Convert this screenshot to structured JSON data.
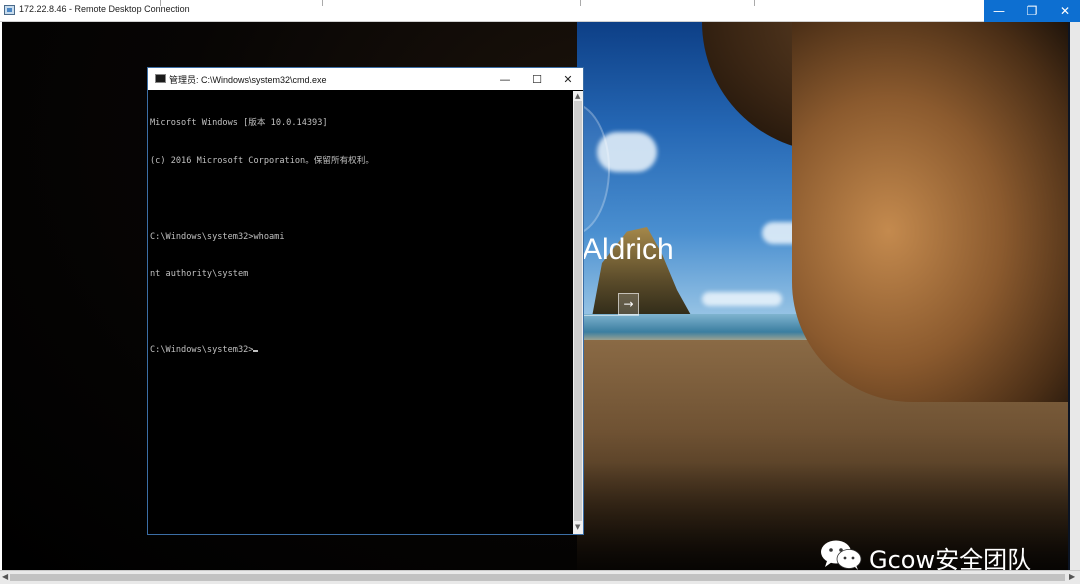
{
  "rdp": {
    "title": "172.22.8.46 - Remote Desktop Connection",
    "controls": {
      "minimize": "—",
      "restore": "❐",
      "close": "✕"
    },
    "accent": "#0d6fd1"
  },
  "lock_screen": {
    "username": "Aldrich",
    "submit_icon": "→"
  },
  "cmd": {
    "title": "管理员: C:\\Windows\\system32\\cmd.exe",
    "controls": {
      "minimize": "—",
      "maximize": "☐",
      "close": "✕"
    },
    "lines": [
      "Microsoft Windows [版本 10.0.14393]",
      "(c) 2016 Microsoft Corporation。保留所有权利。",
      "",
      "C:\\Windows\\system32>whoami",
      "nt authority\\system",
      "",
      "C:\\Windows\\system32>"
    ],
    "scroll_up": "▲",
    "scroll_down": "▼"
  },
  "watermark": {
    "text": "Gcow安全团队"
  },
  "hscroll": {
    "left": "◀",
    "right": "▶"
  }
}
